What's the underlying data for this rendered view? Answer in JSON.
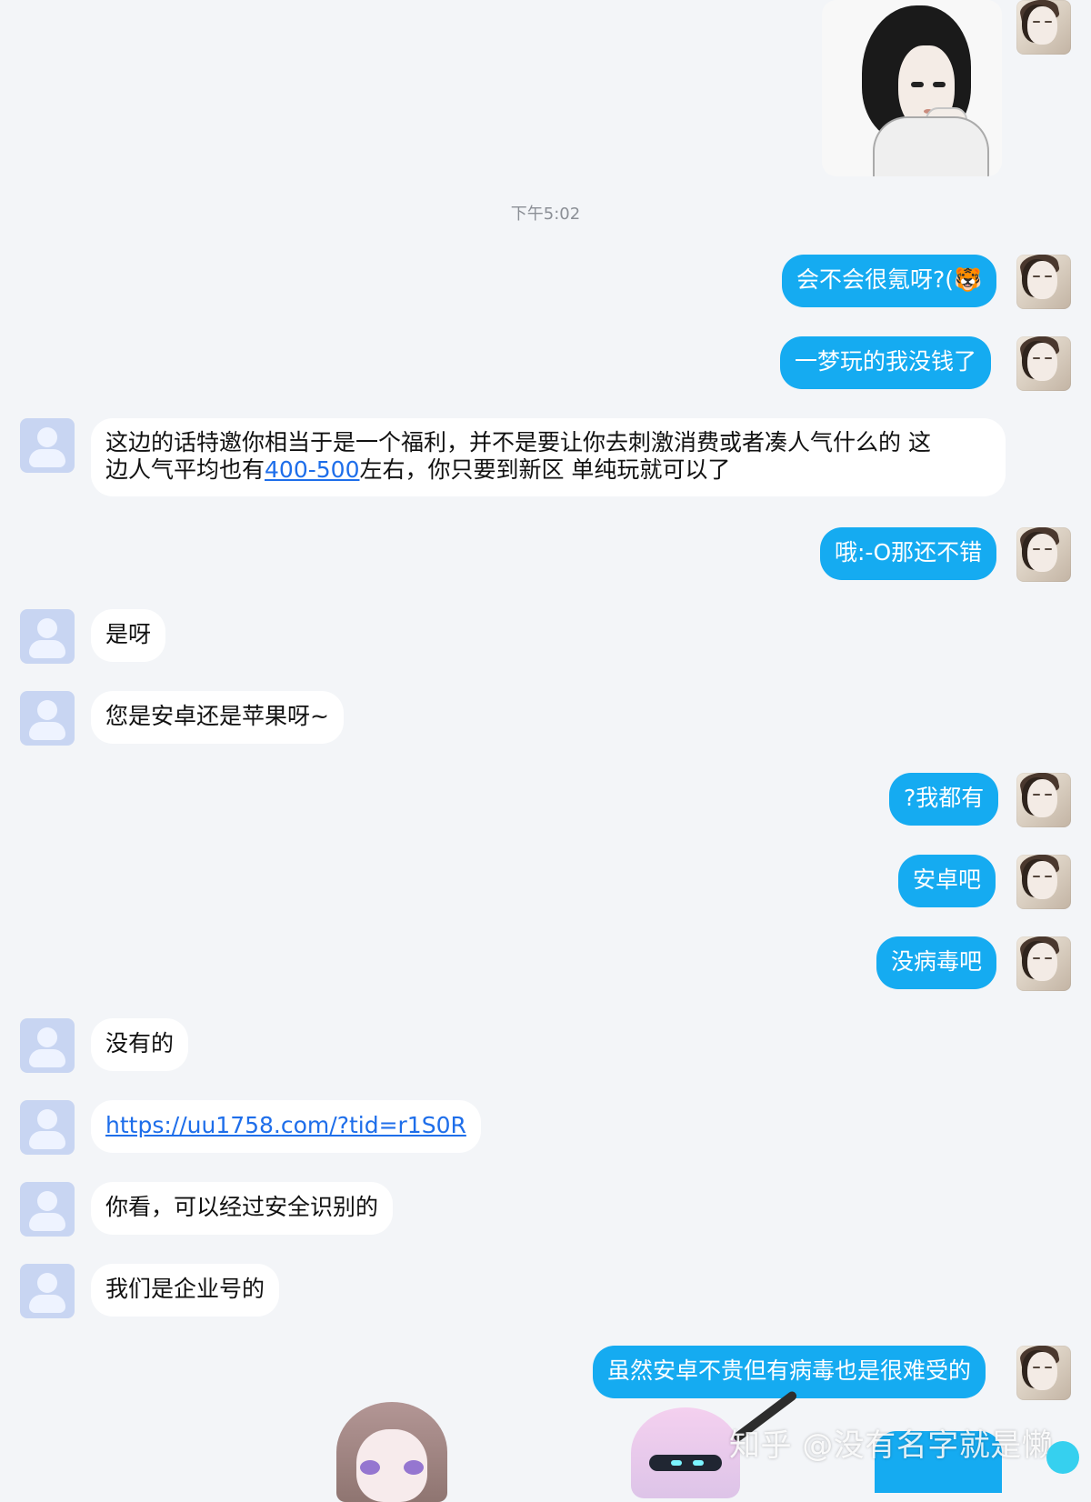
{
  "chat": {
    "timestamp": "下午5:02",
    "messages": [
      {
        "type": "image",
        "sender": "me"
      },
      {
        "type": "text",
        "sender": "me",
        "text": "会不会很氪呀?(🐯"
      },
      {
        "type": "text",
        "sender": "me",
        "text": "一梦玩的我没钱了"
      },
      {
        "type": "text",
        "sender": "other",
        "line1": "这边的话特邀你相当于是一个福利，并不是要让你去刺激消费或者凑人气什么的  这",
        "line2_prefix": "边人气平均也有",
        "line2_link": "400-500",
        "line2_suffix": "左右，你只要到新区  单纯玩就可以了"
      },
      {
        "type": "text",
        "sender": "me",
        "text": "哦:-O那还不错"
      },
      {
        "type": "text",
        "sender": "other",
        "text": "是呀"
      },
      {
        "type": "text",
        "sender": "other",
        "text": "您是安卓还是苹果呀~"
      },
      {
        "type": "text",
        "sender": "me",
        "text": "?我都有"
      },
      {
        "type": "text",
        "sender": "me",
        "text": "安卓吧"
      },
      {
        "type": "text",
        "sender": "me",
        "text": "没病毒吧"
      },
      {
        "type": "text",
        "sender": "other",
        "text": "没有的"
      },
      {
        "type": "link",
        "sender": "other",
        "text": "https://uu1758.com/?tid=r1S0R"
      },
      {
        "type": "text",
        "sender": "other",
        "text": "你看，可以经过安全识别的"
      },
      {
        "type": "text",
        "sender": "other",
        "text": "我们是企业号的"
      },
      {
        "type": "text",
        "sender": "me",
        "text": "虽然安卓不贵但有病毒也是很难受的"
      }
    ],
    "watermark": "知乎 @没有名字就是懒"
  },
  "colors": {
    "background": "#f3f5f8",
    "my_bubble": "#15abf1",
    "other_bubble": "#ffffff",
    "link": "#1e6eea"
  },
  "icons": {
    "other_avatar": "person-placeholder-icon",
    "my_avatar": "portrait-avatar-icon"
  }
}
